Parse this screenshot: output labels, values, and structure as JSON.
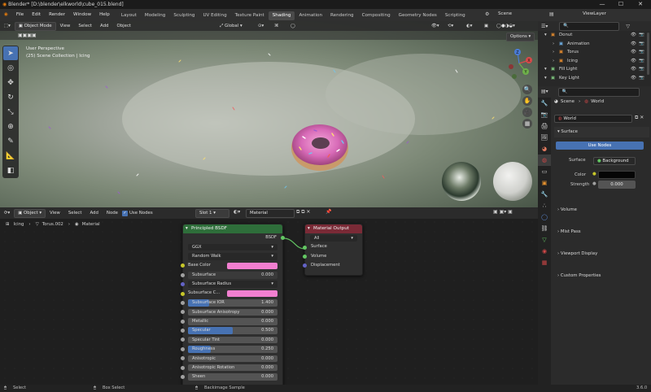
{
  "title_bar": {
    "title": "Blender* [D:\\blender\\elkworld\\cube_015.blend]",
    "minimize": "—",
    "maximize": "☐",
    "close": "✕"
  },
  "top_menu": {
    "items": [
      "File",
      "Edit",
      "Render",
      "Window",
      "Help"
    ],
    "workspaces": [
      "Layout",
      "Modeling",
      "Sculpting",
      "UV Editing",
      "Texture Paint",
      "Shading",
      "Animation",
      "Rendering",
      "Compositing",
      "Geometry Nodes",
      "Scripting"
    ],
    "active_workspace": "Shading",
    "scene_label": "Scene",
    "view_layer_label": "ViewLayer"
  },
  "viewport": {
    "mode": "Object Mode",
    "menus": [
      "View",
      "Select",
      "Add",
      "Object"
    ],
    "transform_orientation": "Global",
    "options_label": "Options",
    "info_line1": "User Perspective",
    "info_line2": "(25) Scene Collection | Icing",
    "gizmo_axes": [
      "X",
      "Y",
      "Z"
    ]
  },
  "node_editor": {
    "editor_type_label": "Object",
    "menus": [
      "View",
      "Select",
      "Add",
      "Node"
    ],
    "use_nodes_label": "Use Nodes",
    "slot_label": "Slot 1",
    "material_name": "Material",
    "breadcrumb": [
      "Icing",
      "Torus.002",
      "Material"
    ],
    "principled_node": {
      "title": "Principled BSDF",
      "output_label": "BSDF",
      "distribution": "GGX",
      "subsurface_method": "Random Walk",
      "rows": [
        {
          "label": "Base Color",
          "type": "color",
          "color": "#f27fd0"
        },
        {
          "label": "Subsurface",
          "value": "0.000",
          "type": "dark"
        },
        {
          "label": "Subsurface Radius",
          "type": "dropdown"
        },
        {
          "label": "Subsurface C...",
          "type": "color",
          "color": "#f27fd0"
        },
        {
          "label": "Subsurface IOR",
          "value": "1.400",
          "type": "fill",
          "fill": 0.24
        },
        {
          "label": "Subsurface Anisotropy",
          "value": "0.000",
          "type": "plain"
        },
        {
          "label": "Metallic",
          "value": "0.000",
          "type": "plain"
        },
        {
          "label": "Specular",
          "value": "0.500",
          "type": "fill",
          "fill": 0.5
        },
        {
          "label": "Specular Tint",
          "value": "0.000",
          "type": "plain"
        },
        {
          "label": "Roughness",
          "value": "0.250",
          "type": "fill",
          "fill": 0.25
        },
        {
          "label": "Anisotropic",
          "value": "0.000",
          "type": "plain"
        },
        {
          "label": "Anisotropic Rotation",
          "value": "0.000",
          "type": "plain"
        },
        {
          "label": "Sheen",
          "value": "0.000",
          "type": "plain"
        }
      ]
    },
    "output_node": {
      "title": "Material Output",
      "target": "All",
      "inputs": [
        "Surface",
        "Volume",
        "Displacement"
      ]
    }
  },
  "outliner": {
    "rows": [
      {
        "label": "Donut",
        "depth": 0,
        "color": "#e38a2e"
      },
      {
        "label": "Animation",
        "depth": 1,
        "color": "#6fb0e6"
      },
      {
        "label": "Torus",
        "depth": 1,
        "color": "#e38a2e"
      },
      {
        "label": "Icing",
        "depth": 1,
        "color": "#e38a2e"
      },
      {
        "label": "Fill Light",
        "depth": 0,
        "color": "#7fc77f"
      },
      {
        "label": "Key Light",
        "depth": 0,
        "color": "#7fc77f"
      }
    ]
  },
  "properties": {
    "breadcrumb_scene": "Scene",
    "breadcrumb_world": "World",
    "world_name": "World",
    "surface_section": "Surface",
    "use_nodes_button": "Use Nodes",
    "surface_label": "Surface",
    "surface_value": "Background",
    "color_label": "Color",
    "strength_label": "Strength",
    "strength_value": "0.000",
    "collapsed_panels": [
      "Volume",
      "Mist Pass",
      "Viewport Display",
      "Custom Properties"
    ]
  },
  "status_bar": {
    "select_label": "Select",
    "box_select_label": "Box Select",
    "backimage_label": "Backimage Sample",
    "version": "3.6.0"
  }
}
